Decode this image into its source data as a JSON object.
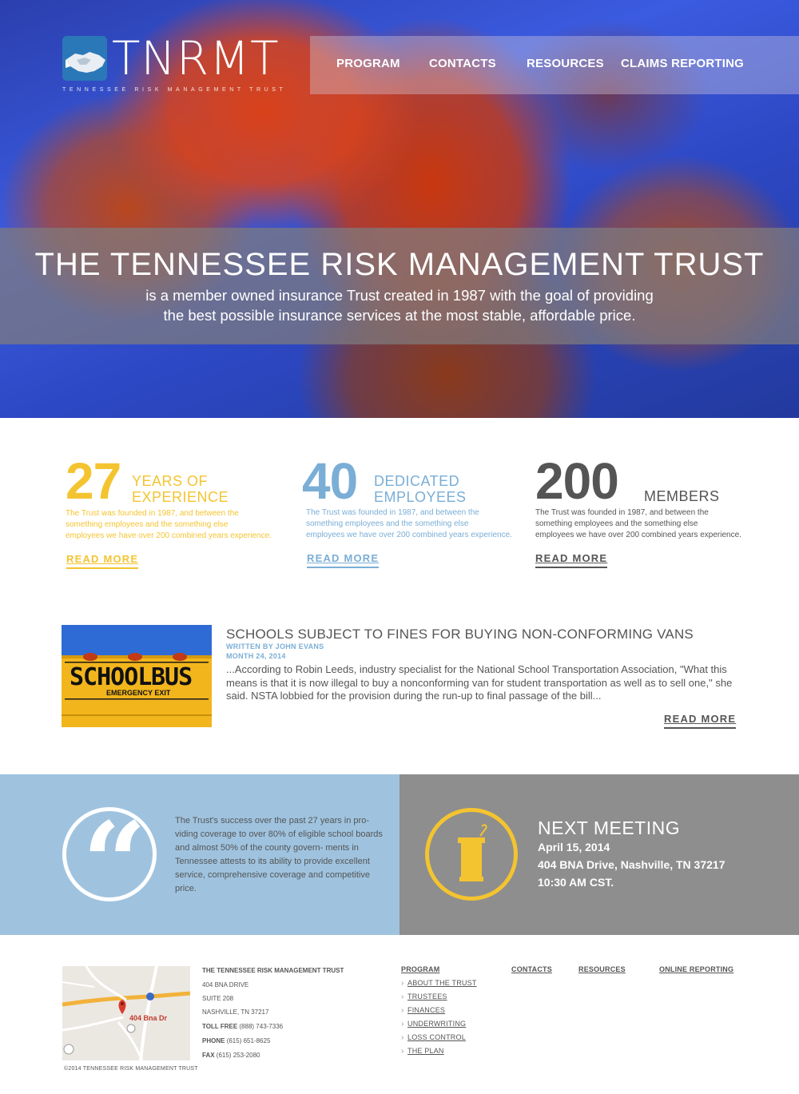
{
  "brand": {
    "name": "TNRMT",
    "tagline": "TENNESSEE RISK MANAGEMENT TRUST",
    "logo_icon": "handshake-icon",
    "colors": {
      "yellow": "#f4c430",
      "blue": "#7aaed6",
      "gray": "#555555"
    }
  },
  "nav": {
    "items": [
      {
        "label": "PROGRAM"
      },
      {
        "label": "CONTACTS"
      },
      {
        "label": "RESOURCES"
      },
      {
        "label": "CLAIMS REPORTING"
      }
    ]
  },
  "hero": {
    "title": "THE TENNESSEE RISK MANAGEMENT TRUST",
    "line1": "is a member owned insurance Trust created in 1987 with the goal of providing",
    "line2": "the best possible insurance services at the most stable, affordable price."
  },
  "stats": [
    {
      "number": "27",
      "label_line1": "YEARS OF",
      "label_line2": "EXPERIENCE",
      "desc_line1": "The  Trust was founded in 1987, and between the",
      "desc_line2": "something employees and the something else",
      "desc_line3": "employees we have over 200 combined years experience.",
      "more": "READ MORE"
    },
    {
      "number": "40",
      "label_line1": "DEDICATED",
      "label_line2": "EMPLOYEES",
      "desc_line1": "The  Trust was founded in 1987, and between the",
      "desc_line2": "something employees and the something else",
      "desc_line3": "employees we have over 200 combined years experience.",
      "more": "READ MORE"
    },
    {
      "number": "200",
      "label_line1": "MEMBERS",
      "label_line2": "",
      "desc_line1": "The  Trust was founded in 1987, and between the",
      "desc_line2": "something employees and the something else",
      "desc_line3": "employees we have over 200 combined years experience.",
      "more": "READ MORE"
    }
  ],
  "article": {
    "image_text_1": "SCHOOL",
    "image_text_2": "BUS",
    "image_text_3": "EMERGENCY EXIT",
    "title": "SCHOOLS SUBJECT TO FINES FOR BUYING NON-CONFORMING VANS",
    "author": "WRITTEN BY JOHN EVANS",
    "date": "MONTH 24, 2014",
    "body": "...According to Robin Leeds, industry specialist for the National School Transportation Association, \"What this means is that it is now illegal to buy a nonconforming van for student transportation as well as to sell one,\" she said. NSTA lobbied for the provision during the run-up to final passage of the bill...",
    "more": "READ MORE"
  },
  "quote": {
    "icon": "quote-icon",
    "mark": "“",
    "text": "The Trust's success over the past 27 years in pro- viding coverage to over 80% of eligible school boards and almost 50% of the county govern- ments in Tennessee attests to its ability to provide excellent service, comprehensive coverage and competitive price."
  },
  "meeting": {
    "icon": "podium-icon",
    "title": "NEXT MEETING",
    "date": "April 15, 2014",
    "address": "404 BNA Drive, Nashville, TN 37217",
    "time": "10:30 AM CST."
  },
  "footer": {
    "map_label": "404 Bna Dr",
    "org": "THE TENNESSEE RISK MANAGEMENT TRUST",
    "street": "404 BNA DRIVE",
    "suite": "SUITE 208",
    "city": "NASHVILLE, TN 37217",
    "tollfree_label": "TOLL FREE",
    "tollfree": "(888) 743-7336",
    "phone_label": "PHONE",
    "phone": "(615) 651-8625",
    "fax_label": "FAX",
    "fax": "(615) 253-2080",
    "copyright": "©2014 TENNESSEE RISK MANAGEMENT TRUST",
    "columns": {
      "program": "PROGRAM",
      "contacts": "CONTACTS",
      "resources": "RESOURCES",
      "online": "ONLINE REPORTING"
    },
    "program_items": [
      "ABOUT THE TRUST",
      "TRUSTEES",
      "FINANCES",
      "UNDERWRITING",
      "LOSS CONTROL",
      "THE PLAN"
    ]
  }
}
